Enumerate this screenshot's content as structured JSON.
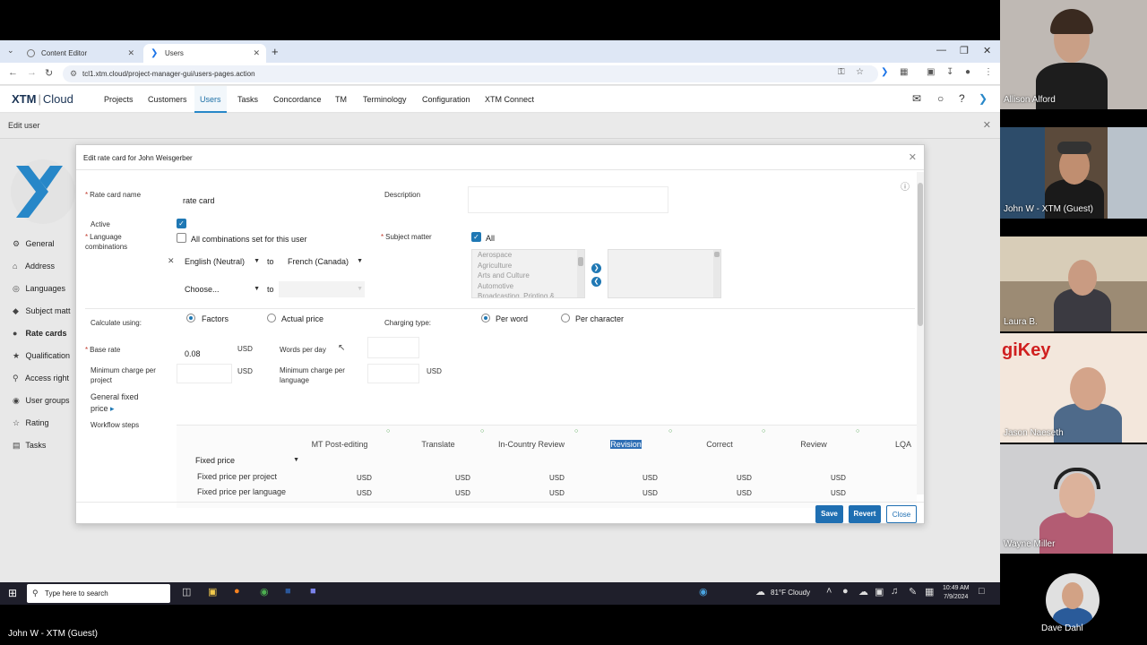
{
  "browser": {
    "tabs": [
      {
        "label": "Content Editor",
        "active": false
      },
      {
        "label": "Users",
        "active": true
      }
    ],
    "url": "tcl1.xtm.cloud/project-manager-gui/users-pages.action"
  },
  "app": {
    "logo_main": "XTM",
    "logo_sub": "Cloud",
    "menu": [
      "Projects",
      "Customers",
      "Users",
      "Tasks",
      "Concordance",
      "TM",
      "Terminology",
      "Configuration",
      "XTM Connect"
    ],
    "active_menu": "Users",
    "page_title": "Edit user"
  },
  "left_menu": [
    "General",
    "Address",
    "Languages",
    "Subject matt",
    "Rate cards",
    "Qualification",
    "Access right",
    "User groups",
    "Rating",
    "Tasks"
  ],
  "modal": {
    "title": "Edit rate card for John Weisgerber",
    "rate_card_name_label": "Rate card name",
    "rate_card_name_value": "rate card",
    "description_label": "Description",
    "active_label": "Active",
    "language_combinations_label": "Language combinations",
    "all_combinations_label": "All combinations set for this user",
    "source_language": "English (Neutral)",
    "to_label": "to",
    "target_language": "French (Canada)",
    "choose_placeholder": "Choose...",
    "subject_matter_label": "Subject matter",
    "all_label": "All",
    "subjects": [
      "Aerospace",
      "Agriculture",
      "Arts and Culture",
      "Automotive",
      "Broadcasting, Printing &"
    ],
    "calculate_using_label": "Calculate using:",
    "factors_label": "Factors",
    "actual_price_label": "Actual price",
    "charging_type_label": "Charging type:",
    "per_word_label": "Per word",
    "per_character_label": "Per character",
    "base_rate_label": "Base rate",
    "base_rate_value": "0.08",
    "currency": "USD",
    "words_per_day_label": "Words per day",
    "min_charge_project_label": "Minimum charge per project",
    "min_charge_language_label": "Minimum charge per language",
    "general_fixed_price_label": "General fixed price",
    "workflow_steps_label": "Workflow steps",
    "workflow_steps": [
      "MT Post-editing",
      "Translate",
      "In-Country Review",
      "Revision",
      "Correct",
      "Review",
      "LQA"
    ],
    "highlighted_step": "Revision",
    "fixed_price_label": "Fixed price",
    "fixed_price_per_project_label": "Fixed price per project",
    "fixed_price_per_language_label": "Fixed price per language",
    "save_label": "Save",
    "revert_label": "Revert",
    "close_label": "Close"
  },
  "taskbar": {
    "search_placeholder": "Type here to search",
    "weather": "81°F  Cloudy",
    "time": "10:49 AM",
    "date": "7/9/2024"
  },
  "participants": [
    {
      "name": "Allison Alford"
    },
    {
      "name": "John W - XTM (Guest)"
    },
    {
      "name": "Laura B."
    },
    {
      "name": "Jason Naeseth"
    },
    {
      "name": "Wayne Miller"
    },
    {
      "name": "Dave Dahl"
    }
  ],
  "bottom_label": "John W - XTM (Guest)",
  "tile_logo_text": "giKey",
  "colors": {
    "accent": "#1f78b4",
    "xtm_blue": "#2787c8",
    "highlight": "#2e6fb5"
  }
}
